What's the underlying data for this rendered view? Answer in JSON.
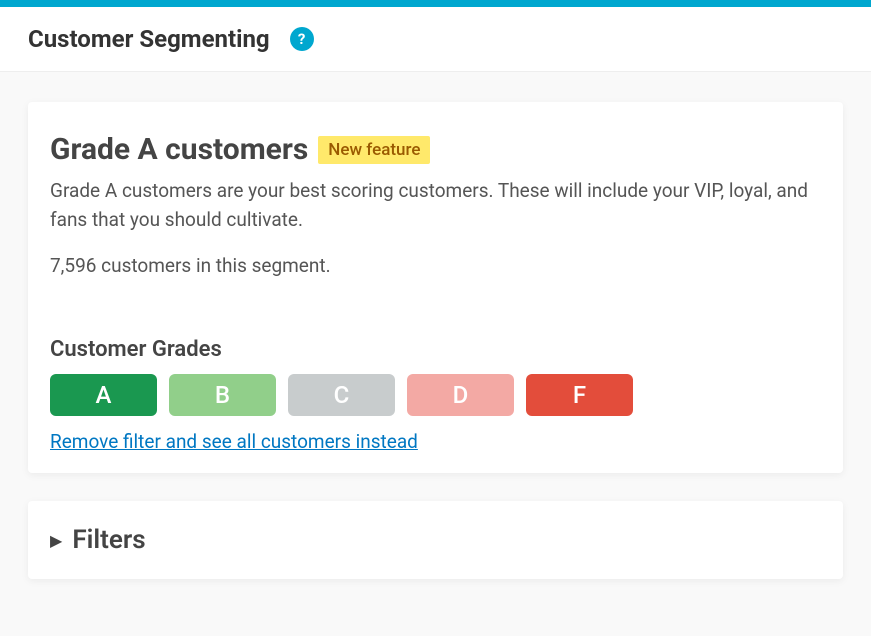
{
  "header": {
    "title": "Customer Segmenting",
    "help_icon_symbol": "?"
  },
  "segment": {
    "title": "Grade A customers",
    "badge_label": "New feature",
    "description": "Grade A customers are your best scoring customers. These will include your VIP, loyal, and fans that you should cultivate.",
    "count_text": "7,596 customers in this segment."
  },
  "grades": {
    "title": "Customer Grades",
    "a": "A",
    "b": "B",
    "c": "C",
    "d": "D",
    "f": "F",
    "remove_filter_label": "Remove filter and see all customers instead"
  },
  "filters": {
    "disclosure_symbol": "▶",
    "title": "Filters"
  }
}
